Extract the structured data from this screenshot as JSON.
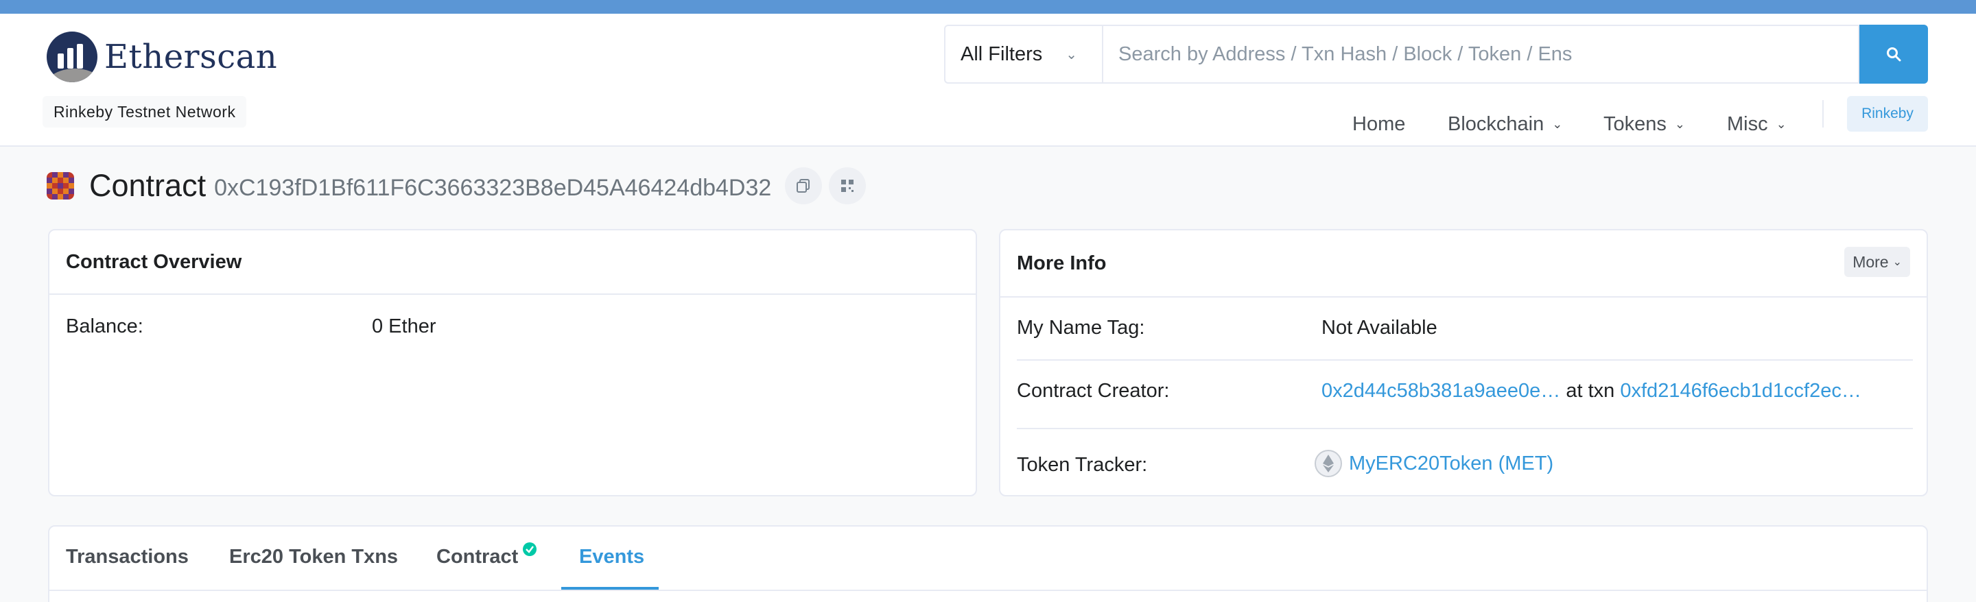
{
  "brand": {
    "name": "Etherscan",
    "network": "Rinkeby Testnet Network"
  },
  "search": {
    "filter_label": "All Filters",
    "placeholder": "Search by Address / Txn Hash / Block / Token / Ens"
  },
  "nav": {
    "home": "Home",
    "blockchain": "Blockchain",
    "tokens": "Tokens",
    "misc": "Misc",
    "network_button": "Rinkeby"
  },
  "page": {
    "title": "Contract",
    "address": "0xC193fD1Bf611F6C3663323B8eD45A46424db4D32"
  },
  "overview": {
    "title": "Contract Overview",
    "balance_label": "Balance:",
    "balance_value": "0 Ether"
  },
  "more_info": {
    "title": "More Info",
    "more_button": "More",
    "name_tag_label": "My Name Tag:",
    "name_tag_value": "Not Available",
    "creator_label": "Contract Creator:",
    "creator_address": "0x2d44c58b381a9aee0e…",
    "at_txn": "at txn",
    "creator_txn": "0xfd2146f6ecb1d1ccf2ec…",
    "token_tracker_label": "Token Tracker:",
    "token_tracker_value": "MyERC20Token (MET)"
  },
  "tabs": {
    "transactions": "Transactions",
    "erc20": "Erc20 Token Txns",
    "contract": "Contract",
    "events": "Events"
  },
  "colors": {
    "accent": "#3498db",
    "topbar": "#5b96d5",
    "brand_navy": "#21325b",
    "verified_green": "#00c9a7"
  }
}
